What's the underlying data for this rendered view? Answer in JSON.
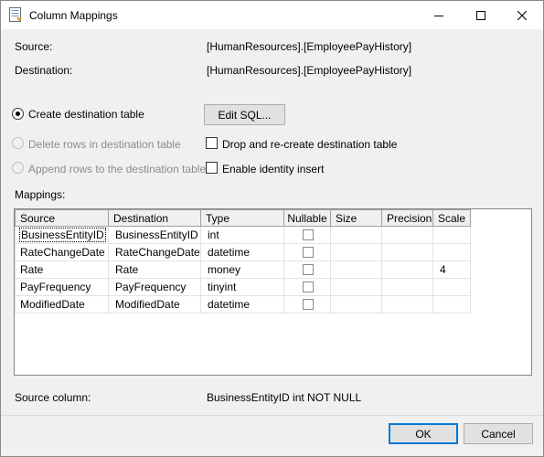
{
  "window": {
    "title": "Column Mappings"
  },
  "source": {
    "label": "Source:",
    "value": "[HumanResources].[EmployeePayHistory]"
  },
  "destination": {
    "label": "Destination:",
    "value": "[HumanResources].[EmployeePayHistory]"
  },
  "options": {
    "create_destination": "Create destination table",
    "delete_rows": "Delete rows in destination table",
    "append_rows": "Append rows to the destination table",
    "edit_sql": "Edit SQL...",
    "drop_recreate": "Drop and re-create destination table",
    "identity_insert": "Enable identity insert"
  },
  "mappings": {
    "label": "Mappings:",
    "columns": [
      "Source",
      "Destination",
      "Type",
      "Nullable",
      "Size",
      "Precision",
      "Scale"
    ],
    "rows": [
      {
        "source": "BusinessEntityID",
        "destination": "BusinessEntityID",
        "type": "int",
        "nullable": false,
        "size": "",
        "precision": "",
        "scale": ""
      },
      {
        "source": "RateChangeDate",
        "destination": "RateChangeDate",
        "type": "datetime",
        "nullable": false,
        "size": "",
        "precision": "",
        "scale": ""
      },
      {
        "source": "Rate",
        "destination": "Rate",
        "type": "money",
        "nullable": false,
        "size": "",
        "precision": "",
        "scale": "4"
      },
      {
        "source": "PayFrequency",
        "destination": "PayFrequency",
        "type": "tinyint",
        "nullable": false,
        "size": "",
        "precision": "",
        "scale": ""
      },
      {
        "source": "ModifiedDate",
        "destination": "ModifiedDate",
        "type": "datetime",
        "nullable": false,
        "size": "",
        "precision": "",
        "scale": ""
      }
    ]
  },
  "source_column": {
    "label": "Source column:",
    "value": "BusinessEntityID int NOT NULL"
  },
  "buttons": {
    "ok": "OK",
    "cancel": "Cancel"
  },
  "colors": {
    "accent": "#0078d7",
    "disabled_text": "#8c8c8c"
  }
}
